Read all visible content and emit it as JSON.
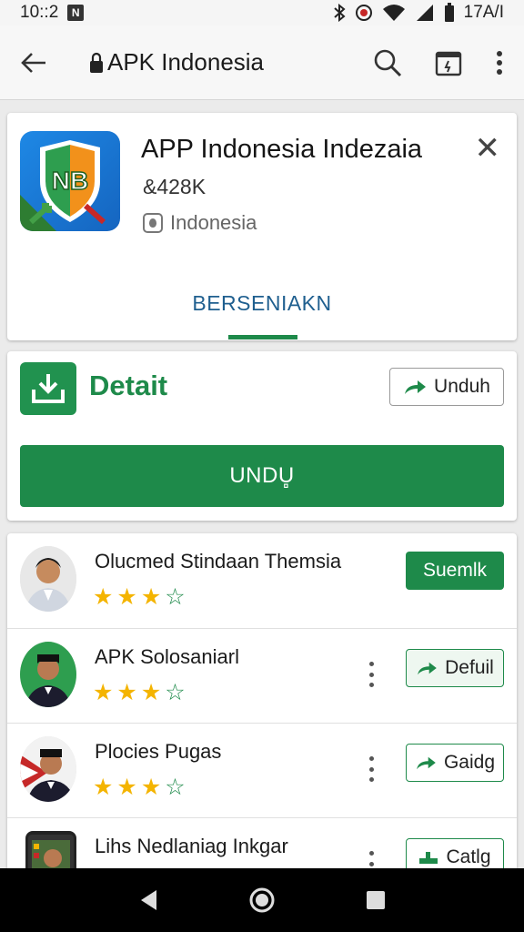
{
  "status_bar": {
    "time": "10::2",
    "app_badge": "N",
    "clock_right": "17A/I"
  },
  "app_bar": {
    "title": "APK Indonesia",
    "icons": [
      "back-arrow-icon",
      "lock-icon",
      "search-icon",
      "calendar-icon",
      "more-vert-icon"
    ]
  },
  "app_card": {
    "title": "APP Indonesia Indezaia",
    "size": "&428K",
    "region": "Indonesia",
    "tab_label": "BERSENIAKN",
    "icon_text": "NB",
    "close_glyph": "✕"
  },
  "download_card": {
    "title": "Detait",
    "unduh_label": "Unduh",
    "main_button_label": "UNDU̻"
  },
  "list": {
    "items": [
      {
        "title": "Olucmed Stindaan Themsia",
        "rating": 3,
        "max_rating": 4,
        "button_label": "Suemlk",
        "button_style": "filled"
      },
      {
        "title": "APK Solosaniarl",
        "rating": 3,
        "max_rating": 4,
        "button_label": "Defuil",
        "button_style": "outline-light",
        "button_icon": "share-arrow-icon"
      },
      {
        "title": "Plocies Pugas",
        "rating": 3,
        "max_rating": 4,
        "button_label": "Gaidg",
        "button_style": "outline",
        "button_icon": "share-arrow-icon"
      },
      {
        "title": "Lihs Nedlaniag Inkgar",
        "rating": 3,
        "max_rating": 4,
        "button_label": "Catlg",
        "button_style": "outline",
        "button_icon": "chart-icon"
      }
    ]
  },
  "colors": {
    "accent_green": "#1e8a4a",
    "tab_blue": "#1f5f8f",
    "star_gold": "#f4b400"
  }
}
